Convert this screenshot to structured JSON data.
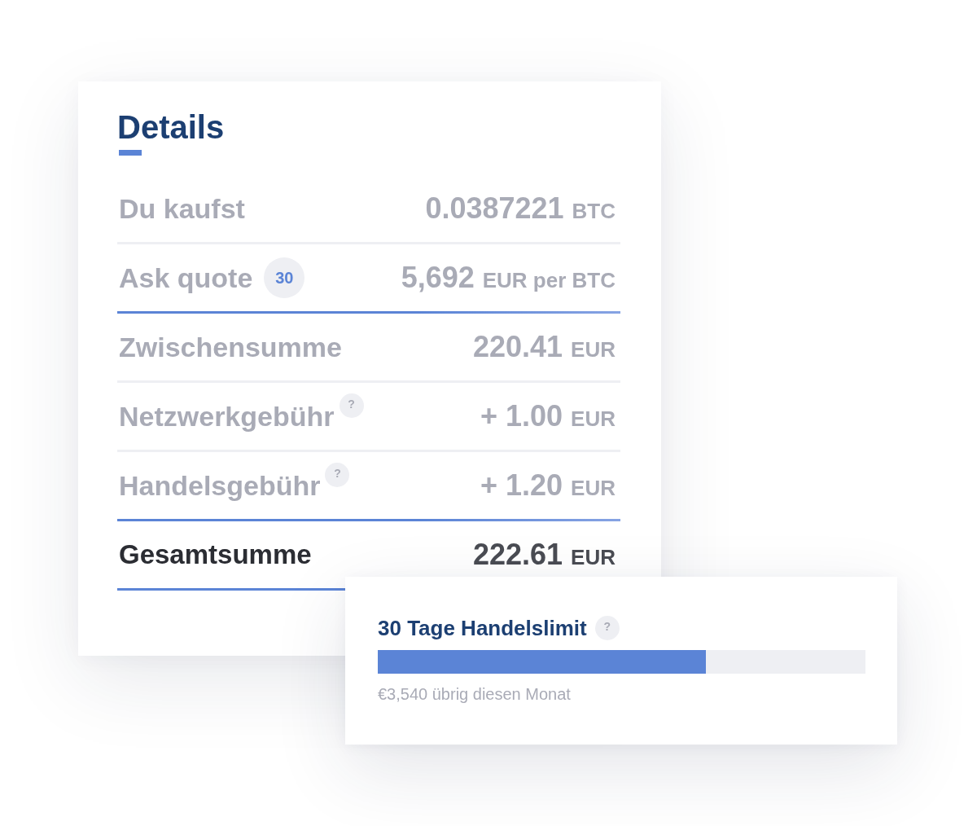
{
  "details": {
    "title": "Details",
    "rows": [
      {
        "kind": "line",
        "label": "Du kaufst",
        "amount": "0.0387221",
        "unit": "BTC",
        "accent_rule": false
      },
      {
        "kind": "line",
        "label": "Ask quote",
        "badge": "30",
        "amount": "5,692",
        "unit": "EUR per BTC",
        "accent_rule": true
      },
      {
        "kind": "line",
        "label": "Zwischensumme",
        "amount": "220.41",
        "unit": "EUR",
        "accent_rule": false
      },
      {
        "kind": "line",
        "label": "Netzwerkgebühr",
        "hint": "?",
        "amount": "+ 1.00",
        "unit": "EUR",
        "accent_rule": false
      },
      {
        "kind": "line",
        "label": "Handelsgebühr",
        "hint": "?",
        "amount": "+ 1.20",
        "unit": "EUR",
        "accent_rule": true
      },
      {
        "kind": "total",
        "label": "Gesamtsumme",
        "amount": "222.61",
        "unit": "EUR",
        "accent_rule": true
      }
    ]
  },
  "trade_limit": {
    "title": "30 Tage Handelslimit",
    "hint": "?",
    "level": 0.673,
    "caption": "€3,540 übrig diesen Monat"
  }
}
